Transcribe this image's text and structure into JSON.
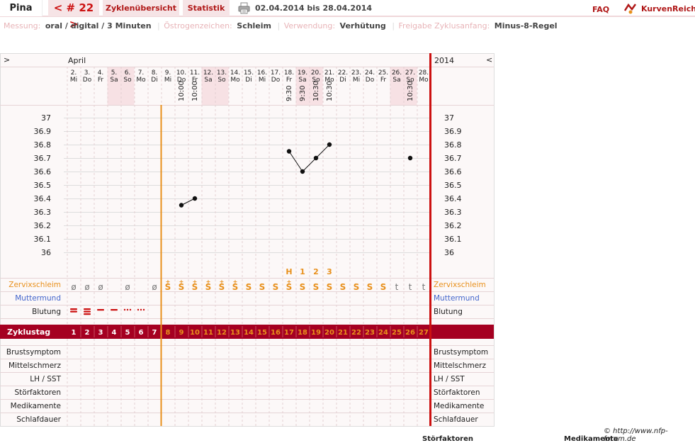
{
  "header": {
    "user_name": "Pina",
    "cycle_nav": "< # 22 >",
    "tab_overview": "Zyklenübersicht",
    "tab_stats": "Statistik",
    "date_range": "02.04.2014 bis 28.04.2014",
    "faq": "FAQ",
    "brand": "KurvenReich"
  },
  "info": [
    {
      "key": "Messung:",
      "value": "oral / digital / 3 Minuten"
    },
    {
      "key": "Östrogenzeichen:",
      "value": "Schleim"
    },
    {
      "key": "Verwendung:",
      "value": "Verhütung"
    },
    {
      "key": "Freigabe Zyklusanfang:",
      "value": "Minus-8-Regel"
    }
  ],
  "nav": {
    "left": ">",
    "right": "<"
  },
  "month": "April",
  "year": "2014",
  "colors": {
    "accent": "#a50021",
    "orange": "#e8901c",
    "pink": "#f6e4e6",
    "red_line": "#cc1111"
  },
  "chart_data": {
    "type": "line",
    "days": [
      {
        "date": "2.",
        "weekday": "Mi",
        "cycle_day": "1",
        "time": "",
        "temp": null,
        "mucus": "ø",
        "bleeding": "heavy"
      },
      {
        "date": "3.",
        "weekday": "Do",
        "cycle_day": "2",
        "time": "",
        "temp": null,
        "mucus": "ø",
        "bleeding": "heavy"
      },
      {
        "date": "4.",
        "weekday": "Fr",
        "cycle_day": "3",
        "time": "",
        "temp": null,
        "mucus": "ø",
        "bleeding": "medium"
      },
      {
        "date": "5.",
        "weekday": "Sa",
        "cycle_day": "4",
        "time": "",
        "temp": null,
        "mucus": "",
        "bleeding": "medium"
      },
      {
        "date": "6.",
        "weekday": "So",
        "cycle_day": "5",
        "time": "",
        "temp": null,
        "mucus": "ø",
        "bleeding": "spotting"
      },
      {
        "date": "7.",
        "weekday": "Mo",
        "cycle_day": "6",
        "time": "",
        "temp": null,
        "mucus": "",
        "bleeding": "spotting"
      },
      {
        "date": "8.",
        "weekday": "Di",
        "cycle_day": "7",
        "time": "",
        "temp": null,
        "mucus": "ø",
        "bleeding": ""
      },
      {
        "date": "9.",
        "weekday": "Mi",
        "cycle_day": "8",
        "time": "",
        "temp": null,
        "mucus": "S+",
        "bleeding": ""
      },
      {
        "date": "10.",
        "weekday": "Do",
        "cycle_day": "9",
        "time": "10:00",
        "temp": 36.35,
        "mucus": "S+",
        "bleeding": ""
      },
      {
        "date": "11.",
        "weekday": "Fr",
        "cycle_day": "10",
        "time": "10:00",
        "temp": 36.4,
        "mucus": "S+",
        "bleeding": ""
      },
      {
        "date": "12.",
        "weekday": "Sa",
        "cycle_day": "11",
        "time": "",
        "temp": null,
        "mucus": "S+",
        "bleeding": ""
      },
      {
        "date": "13.",
        "weekday": "So",
        "cycle_day": "12",
        "time": "",
        "temp": null,
        "mucus": "S+",
        "bleeding": ""
      },
      {
        "date": "14.",
        "weekday": "Mo",
        "cycle_day": "13",
        "time": "",
        "temp": null,
        "mucus": "S+",
        "bleeding": ""
      },
      {
        "date": "15.",
        "weekday": "Di",
        "cycle_day": "14",
        "time": "",
        "temp": null,
        "mucus": "S",
        "bleeding": ""
      },
      {
        "date": "16.",
        "weekday": "Mi",
        "cycle_day": "15",
        "time": "",
        "temp": null,
        "mucus": "S",
        "bleeding": ""
      },
      {
        "date": "17.",
        "weekday": "Do",
        "cycle_day": "16",
        "time": "",
        "temp": null,
        "mucus": "S",
        "bleeding": ""
      },
      {
        "date": "18.",
        "weekday": "Fr",
        "cycle_day": "17",
        "time": "9:30",
        "temp": 36.75,
        "mucus": "S+",
        "bleeding": ""
      },
      {
        "date": "19.",
        "weekday": "Sa",
        "cycle_day": "18",
        "time": "9:30",
        "temp": 36.6,
        "mucus": "S",
        "bleeding": ""
      },
      {
        "date": "20.",
        "weekday": "So",
        "cycle_day": "19",
        "time": "10:30",
        "temp": 36.7,
        "mucus": "S",
        "bleeding": ""
      },
      {
        "date": "21.",
        "weekday": "Mo",
        "cycle_day": "20",
        "time": "10:30",
        "temp": 36.8,
        "mucus": "S",
        "bleeding": ""
      },
      {
        "date": "22.",
        "weekday": "Di",
        "cycle_day": "21",
        "time": "",
        "temp": null,
        "mucus": "S",
        "bleeding": ""
      },
      {
        "date": "23.",
        "weekday": "Mi",
        "cycle_day": "22",
        "time": "",
        "temp": null,
        "mucus": "S",
        "bleeding": ""
      },
      {
        "date": "24.",
        "weekday": "Do",
        "cycle_day": "23",
        "time": "",
        "temp": null,
        "mucus": "S",
        "bleeding": ""
      },
      {
        "date": "25.",
        "weekday": "Fr",
        "cycle_day": "24",
        "time": "",
        "temp": null,
        "mucus": "S",
        "bleeding": ""
      },
      {
        "date": "26.",
        "weekday": "Sa",
        "cycle_day": "25",
        "time": "",
        "temp": null,
        "mucus": "t",
        "bleeding": ""
      },
      {
        "date": "27.",
        "weekday": "So",
        "cycle_day": "26",
        "time": "10:30",
        "temp": 36.7,
        "mucus": "t",
        "bleeding": ""
      },
      {
        "date": "28.",
        "weekday": "Mo",
        "cycle_day": "27",
        "time": "",
        "temp": null,
        "mucus": "t",
        "bleeding": ""
      }
    ],
    "y_ticks": [
      "37",
      "36.9",
      "36.8",
      "36.7",
      "36.6",
      "36.5",
      "36.4",
      "36.3",
      "36.2",
      "36.1",
      "36"
    ],
    "ylim": [
      36,
      37
    ],
    "peak_markers": [
      {
        "day_index": 16,
        "label": "H"
      },
      {
        "day_index": 17,
        "label": "1"
      },
      {
        "day_index": 18,
        "label": "2"
      },
      {
        "day_index": 19,
        "label": "3"
      }
    ],
    "rows": {
      "mucus": "Zervixschleim",
      "cervix": "Muttermund",
      "bleeding": "Blutung",
      "cycle_day": "Zyklustag",
      "extra": [
        "Brustsymptom",
        "Mittelschmerz",
        "LH / SST",
        "Störfaktoren",
        "Medikamente",
        "Schlafdauer"
      ]
    }
  },
  "footer": {
    "credit": "© http://www.nfp-forum.de",
    "cut_left": "Störfaktoren",
    "cut_right": "Medikamente"
  }
}
